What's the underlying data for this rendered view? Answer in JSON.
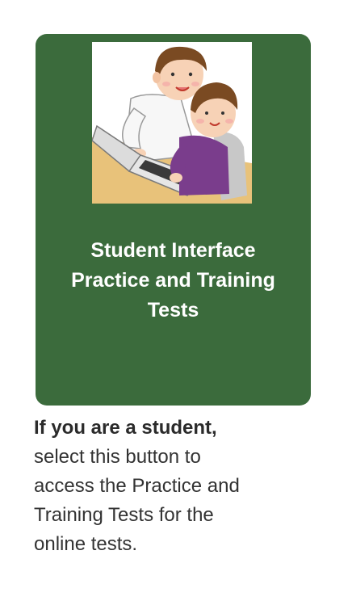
{
  "card": {
    "title_lines": [
      "Student Interface",
      "Practice and Training",
      "Tests"
    ],
    "background_color": "#3b6b3c",
    "illustration_icon": "teacher-and-student-at-laptop-illustration"
  },
  "description": {
    "lead": "If you are a student,",
    "lines": [
      "select this button to",
      "access the Practice and",
      "Training Tests for the",
      "online tests."
    ]
  }
}
